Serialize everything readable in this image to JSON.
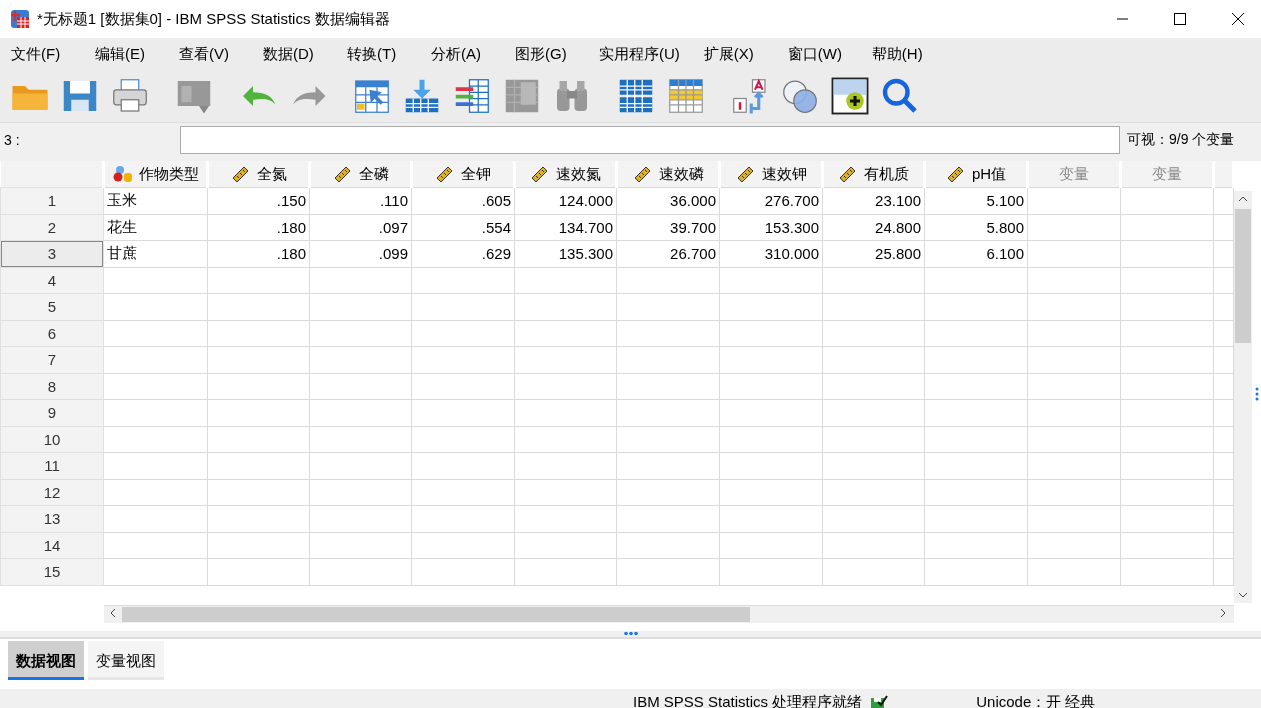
{
  "window": {
    "title": "*无标题1 [数据集0] - IBM SPSS Statistics 数据编辑器"
  },
  "menu": [
    {
      "label": "文件(F)"
    },
    {
      "label": "编辑(E)"
    },
    {
      "label": "查看(V)"
    },
    {
      "label": "数据(D)"
    },
    {
      "label": "转换(T)"
    },
    {
      "label": "分析(A)"
    },
    {
      "label": "图形(G)"
    },
    {
      "label": "实用程序(U)"
    },
    {
      "label": "扩展(X)"
    },
    {
      "label": "窗口(W)"
    },
    {
      "label": "帮助(H)"
    }
  ],
  "toolbar": [
    {
      "kind": "open",
      "disabled": false
    },
    {
      "kind": "save",
      "disabled": false
    },
    {
      "kind": "print",
      "disabled": false
    },
    {
      "kind": "dialog",
      "disabled": true
    },
    {
      "kind": "undo",
      "disabled": false
    },
    {
      "kind": "redo",
      "disabled": true
    },
    {
      "kind": "goto-case",
      "disabled": false
    },
    {
      "kind": "goto-var",
      "disabled": false
    },
    {
      "kind": "variables",
      "disabled": false
    },
    {
      "kind": "stats",
      "disabled": true
    },
    {
      "kind": "find",
      "disabled": true
    },
    {
      "kind": "split",
      "disabled": false
    },
    {
      "kind": "select",
      "disabled": false
    },
    {
      "kind": "value-labels",
      "disabled": false
    },
    {
      "kind": "sets",
      "disabled": false
    },
    {
      "kind": "add",
      "disabled": false
    },
    {
      "kind": "search",
      "disabled": false
    }
  ],
  "cell_editor": {
    "cell": "3 :",
    "value_info": "可视：9/9 个变量"
  },
  "table": {
    "columns": [
      {
        "name": "作物类型",
        "kind": "string"
      },
      {
        "name": "全氮",
        "kind": "scale"
      },
      {
        "name": "全磷",
        "kind": "scale"
      },
      {
        "name": "全钾",
        "kind": "scale"
      },
      {
        "name": "速效氮",
        "kind": "scale"
      },
      {
        "name": "速效磷",
        "kind": "scale"
      },
      {
        "name": "速效钾",
        "kind": "scale"
      },
      {
        "name": "有机质",
        "kind": "scale"
      },
      {
        "name": "pH值",
        "kind": "scale"
      },
      {
        "name": "变量",
        "kind": "empty"
      },
      {
        "name": "变量",
        "kind": "empty"
      }
    ],
    "rows": [
      {
        "number": "1",
        "selected": false,
        "cells": [
          "玉米",
          ".150",
          ".110",
          ".605",
          "124.000",
          "36.000",
          "276.700",
          "23.100",
          "5.100"
        ]
      },
      {
        "number": "2",
        "selected": false,
        "cells": [
          "花生",
          ".180",
          ".097",
          ".554",
          "134.700",
          "39.700",
          "153.300",
          "24.800",
          "5.800"
        ]
      },
      {
        "number": "3",
        "selected": true,
        "cells": [
          "甘蔗",
          ".180",
          ".099",
          ".629",
          "135.300",
          "26.700",
          "310.000",
          "25.800",
          "6.100"
        ]
      },
      {
        "number": "4",
        "selected": false,
        "cells": []
      },
      {
        "number": "5",
        "selected": false,
        "cells": []
      },
      {
        "number": "6",
        "selected": false,
        "cells": []
      },
      {
        "number": "7",
        "selected": false,
        "cells": []
      },
      {
        "number": "8",
        "selected": false,
        "cells": []
      },
      {
        "number": "9",
        "selected": false,
        "cells": []
      },
      {
        "number": "10",
        "selected": false,
        "cells": []
      },
      {
        "number": "11",
        "selected": false,
        "cells": []
      },
      {
        "number": "12",
        "selected": false,
        "cells": []
      },
      {
        "number": "13",
        "selected": false,
        "cells": []
      },
      {
        "number": "14",
        "selected": false,
        "cells": []
      },
      {
        "number": "15",
        "selected": false,
        "cells": []
      }
    ]
  },
  "view_tabs": [
    {
      "label": "数据视图",
      "selected": true
    },
    {
      "label": "变量视图",
      "selected": false
    }
  ],
  "status_bar": {
    "processor": "IBM SPSS Statistics 处理程序就绪",
    "unicode": "Unicode：开 经典"
  }
}
